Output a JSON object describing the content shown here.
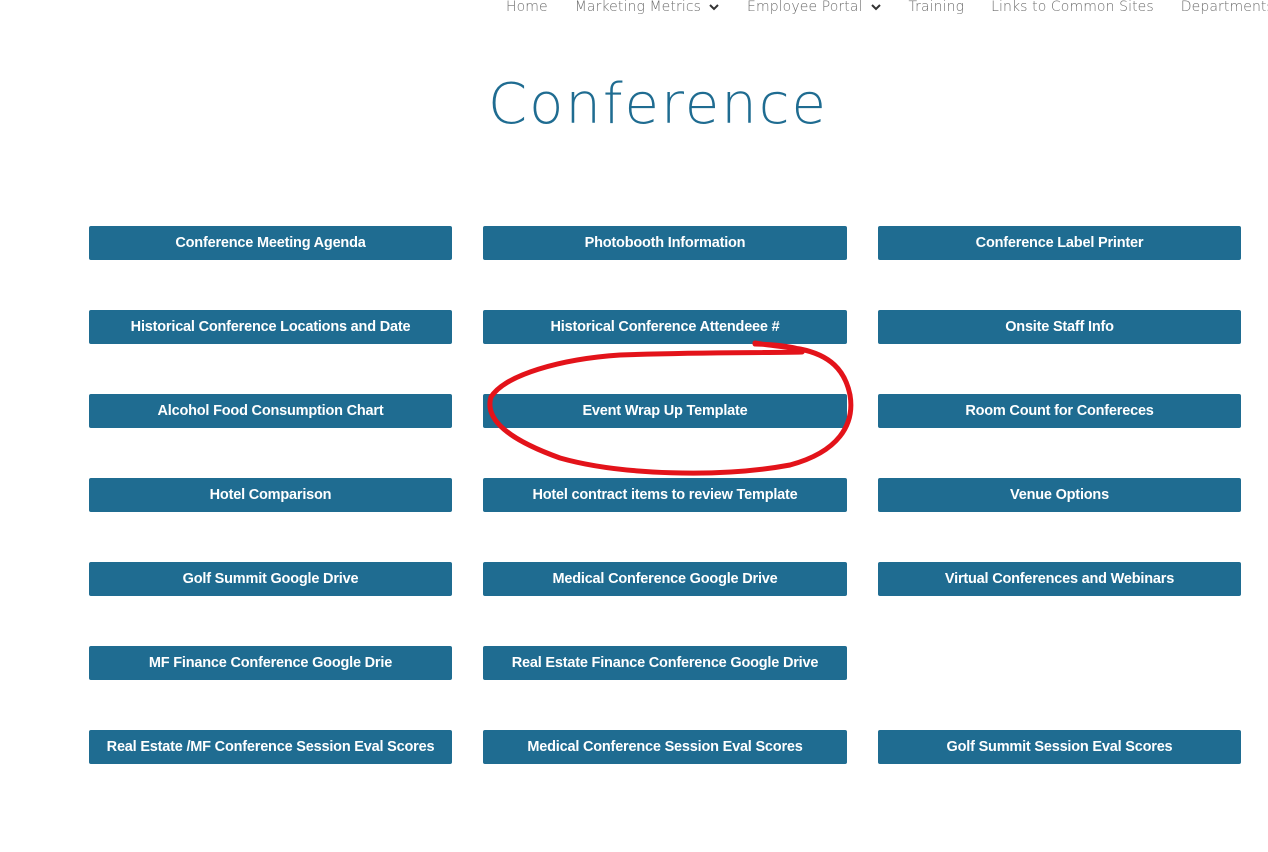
{
  "nav": {
    "items": [
      {
        "label": "Home",
        "has_dropdown": false
      },
      {
        "label": "Marketing Metrics",
        "has_dropdown": true
      },
      {
        "label": "Employee Portal",
        "has_dropdown": true
      },
      {
        "label": "Training",
        "has_dropdown": false
      },
      {
        "label": "Links to Common Sites",
        "has_dropdown": false
      },
      {
        "label": "Departments",
        "has_dropdown": true
      }
    ]
  },
  "page": {
    "title": "Conference"
  },
  "buttons": {
    "r1c1": "Conference Meeting Agenda",
    "r1c2": "Photobooth Information",
    "r1c3": "Conference Label Printer",
    "r2c1": "Historical Conference Locations and Date",
    "r2c2": "Historical Conference Attendeee #",
    "r2c3": "Onsite Staff Info",
    "r3c1": "Alcohol Food Consumption Chart",
    "r3c2": "Event Wrap Up Template",
    "r3c3": "Room Count for Confereces",
    "r4c1": "Hotel Comparison",
    "r4c2": "Hotel contract items to review Template",
    "r4c3": "Venue Options",
    "r5c1": "Golf Summit Google Drive",
    "r5c2": "Medical Conference Google Drive",
    "r5c3": "Virtual Conferences and Webinars",
    "r6c1": "MF Finance Conference Google Drie",
    "r6c2": "Real Estate Finance Conference Google Drive",
    "r7c1": "Real Estate /MF Conference Session Eval Scores",
    "r7c2": "Medical Conference Session Eval Scores",
    "r7c3": "Golf Summit Session Eval Scores"
  },
  "colors": {
    "brand": "#1f6c91",
    "button_text": "#ffffff",
    "nav_text": "#6f6f6f",
    "annotation": "#e3131a"
  },
  "icons": {
    "dropdown": "chevron-down-icon"
  }
}
